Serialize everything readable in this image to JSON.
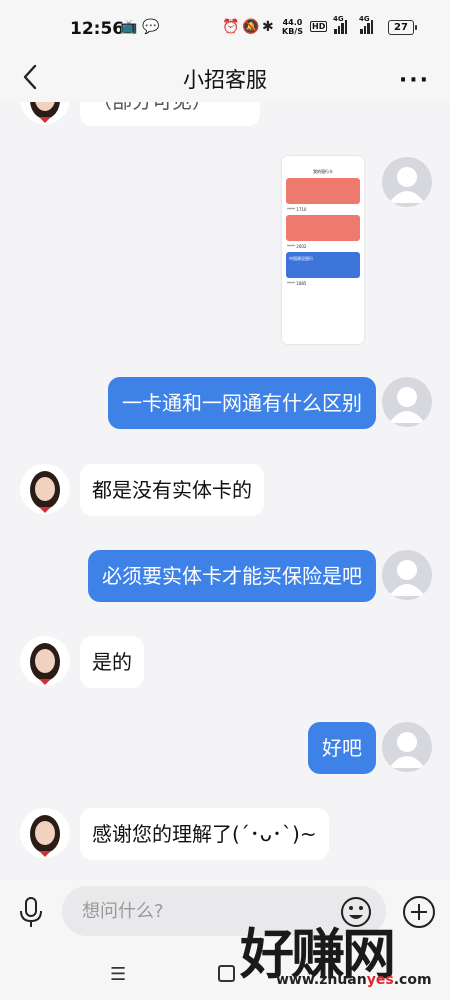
{
  "status_bar": {
    "time": "12:56",
    "net_speed": "44.0",
    "net_unit": "KB/S",
    "hd": "HD",
    "sig1": "4G",
    "sig2": "4G",
    "battery": "27"
  },
  "header": {
    "title": "小招客服",
    "back_icon": "chevron-left-icon",
    "more_icon": "more-dots-icon",
    "more_label": "···"
  },
  "messages": [
    {
      "from": "agent",
      "text": "（部分可见）",
      "partial": true
    },
    {
      "from": "user",
      "type": "image",
      "image_desc": "screenshot"
    },
    {
      "from": "user",
      "text": "一卡通和一网通有什么区别"
    },
    {
      "from": "agent",
      "text": "都是没有实体卡的"
    },
    {
      "from": "user",
      "text": "必须要实体卡才能买保险是吧"
    },
    {
      "from": "agent",
      "text": "是的"
    },
    {
      "from": "user",
      "text": "好吧"
    },
    {
      "from": "agent",
      "text": "感谢您的理解了(´･ᴗ･`)~"
    }
  ],
  "thumb": {
    "title": "我的银行卡",
    "card1_num": "**** 1710",
    "card2_num": "**** 2602",
    "card3_label": "中国建设银行",
    "card3_num": "**** 1885"
  },
  "input_bar": {
    "placeholder": "想问什么?",
    "mic_icon": "microphone-icon",
    "emoji_icon": "emoji-icon",
    "plus_icon": "plus-circle-icon"
  },
  "nav_bar": {
    "menu_glyph": "☰"
  },
  "watermark": {
    "text": "好赚网",
    "url_pre": "www.zhuan",
    "url_hl": "yes",
    "url_post": ".com"
  },
  "colors": {
    "accent": "#3f82e7",
    "background": "#f4f4f6"
  }
}
